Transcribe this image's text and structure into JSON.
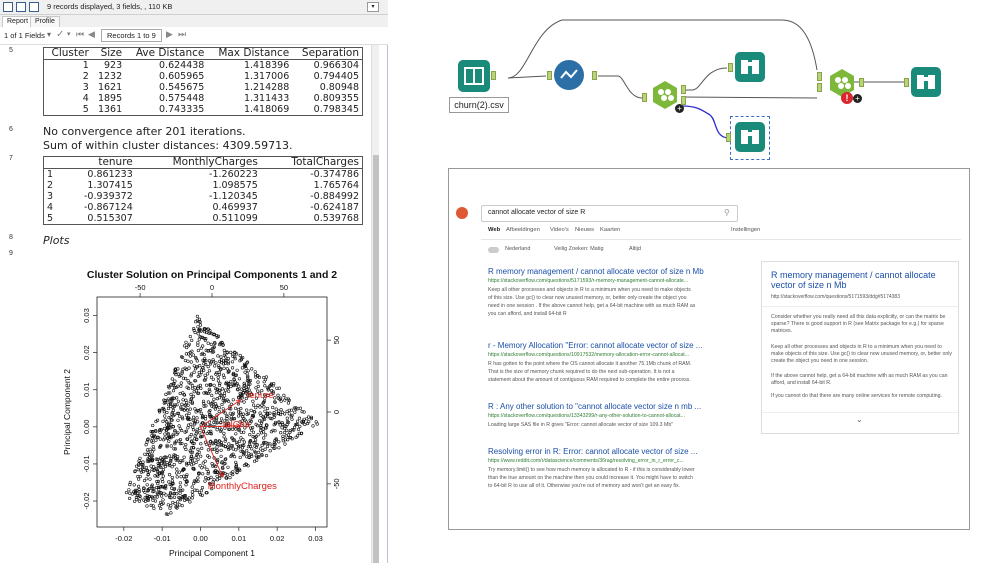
{
  "report": {
    "status": "9 records displayed, 3 fields, , 110 KB",
    "tabs": [
      "Report",
      "Profile"
    ],
    "fields": "1 of 1 Fields",
    "records": "Records 1 to 9",
    "rows": [
      {
        "num": "5"
      },
      {
        "num": "6",
        "lines": [
          "No convergence after 201 iterations.",
          "Sum of within cluster distances: 4309.59713."
        ]
      },
      {
        "num": "7"
      },
      {
        "num": "8",
        "text": "Plots"
      },
      {
        "num": "9"
      }
    ],
    "cluster_table": {
      "headers": [
        "Cluster",
        "Size",
        "Ave Distance",
        "Max Distance",
        "Separation"
      ],
      "rows": [
        [
          "1",
          "923",
          "0.624438",
          "1.418396",
          "0.966304"
        ],
        [
          "2",
          "1232",
          "0.605965",
          "1.317006",
          "0.794405"
        ],
        [
          "3",
          "1621",
          "0.545675",
          "1.214288",
          "0.80948"
        ],
        [
          "4",
          "1895",
          "0.575448",
          "1.311433",
          "0.809355"
        ],
        [
          "5",
          "1361",
          "0.743335",
          "1.418069",
          "0.798345"
        ]
      ]
    },
    "centers_table": {
      "headers": [
        "",
        "tenure",
        "MonthlyCharges",
        "TotalCharges"
      ],
      "rows": [
        [
          "1",
          "0.861233",
          "-1.260223",
          "-0.374786"
        ],
        [
          "2",
          "1.307415",
          "1.098575",
          "1.765764"
        ],
        [
          "3",
          "-0.939372",
          "-1.120345",
          "-0.884992"
        ],
        [
          "4",
          "-0.867124",
          "0.469937",
          "-0.624187"
        ],
        [
          "5",
          "0.515307",
          "0.511099",
          "0.539768"
        ]
      ]
    }
  },
  "chart_data": {
    "type": "scatter",
    "title": "Cluster Solution on Principal Components 1 and 2",
    "xlabel": "Principal Component 1",
    "ylabel": "Principal Component 2",
    "xlim": [
      -0.027,
      0.033
    ],
    "ylim": [
      -0.027,
      0.035
    ],
    "x_ticks": [
      "-0.02",
      "-0.01",
      "0.00",
      "0.01",
      "0.02",
      "0.03"
    ],
    "y_ticks": [
      "-0.02",
      "-0.01",
      "0.00",
      "0.01",
      "0.02",
      "0.03"
    ],
    "top_ticks": [
      "-50",
      "0",
      "50"
    ],
    "right_ticks": [
      "-50",
      "0",
      "50"
    ],
    "vectors": [
      {
        "name": "tenure",
        "x": 0.0105,
        "y": 0.0073
      },
      {
        "name": "TotalCharges",
        "x": 0.0105,
        "y": 0.0003
      },
      {
        "name": "MonthlyCharges",
        "x": 0.0058,
        "y": -0.0135
      }
    ],
    "vector_label_shown": [
      "tenure",
      "talCha",
      "MonthlyCharges"
    ],
    "point_region": [
      [
        -0.02,
        -0.019
      ],
      [
        -0.001,
        0.03
      ],
      [
        0.031,
        0.001
      ],
      [
        -0.008,
        -0.024
      ]
    ],
    "grid": false,
    "legend": "none"
  },
  "workflow": {
    "input_label": "churn(2).csv",
    "tools": [
      "input-book-icon",
      "transform-icon",
      "cluster-icon",
      "browse-icon",
      "browse-icon",
      "cluster-icon",
      "browse-icon",
      "browse-icon"
    ],
    "colors": {
      "teal": "#1a8a7a",
      "blue": "#2c6fa6",
      "green": "#7db83a",
      "error": "#d9272e"
    }
  },
  "browser": {
    "search_query": "cannot allocate vector of size R",
    "tabs": [
      "Web",
      "Afbeeldingen",
      "Video's",
      "Nieuws",
      "Kaarten"
    ],
    "settings": "Instellingen",
    "filters": [
      "Nederland",
      "Veilig Zoeken: Matig",
      "Altijd"
    ],
    "results": [
      {
        "title": "R memory management / cannot allocate vector of size n Mb",
        "url": "https://stackoverflow.com/questions/5171593/r-memory-management-cannot-allocate...",
        "snippet": [
          "Keep all other processes and objects in R to a minimum when you need to make objects",
          "of this size. Use gc() to clear now unused memory, or, better only create the object you",
          "need in one session . If the above cannot help, get a 64-bit machine with as much RAM as",
          "you can afford, and install 64-bit R"
        ]
      },
      {
        "title": "r - Memory Allocation \"Error: cannot allocate vector of size ...",
        "url": "https://stackoverflow.com/questions/10917532/memory-allocation-error-cannot-allocat...",
        "snippet": [
          "R has gotten to the point where the OS cannot allocate it another 75.1Mb chunk of RAM.",
          "That is the size of memory chunk required to do the next sub-operation. It is not a",
          "statement about the amount of contiguous RAM required to complete the entire process."
        ]
      },
      {
        "title": "R : Any other solution to \"cannot allocate vector size n mb ...",
        "url": "https://stackoverflow.com/questions/13343299/r-any-other-solution-to-cannot-allocat...",
        "snippet": [
          "Loading large SAS file in R gives \"Error: cannot allocate vector of size 109.3 Mb\""
        ]
      },
      {
        "title": "Resolving error in R: Error: cannot allocate vector of size ...",
        "url": "https://www.reddit.com/r/datascience/comments/36rag/resolving_error_in_r_error_c...",
        "snippet": [
          "Try memory.limit() to see how much memory is allocated to R - if this is considerably lower",
          "than the true amount on the machine then you could increase it. You might have to switch",
          "to 64-bit R to use all of it. Otherwise you're out of memory and won't get an easy fix."
        ]
      }
    ],
    "sidebar": {
      "title": "R memory management / cannot allocate vector of size n Mb",
      "url": "http://stackoverflow.com/questions/5171593/ddg#5174383",
      "paragraphs": [
        "Consider whether you really need all this data explicitly, or can the matrix be sparse? There is good support in R (see Matrix package for e.g.) for sparse matrices.",
        "Keep all other processes and objects in R to a minimum when you need to make objects of this size. Use gc() to clear now unused memory, or, better only create the object you need in one session.",
        "If the above cannot help, get a 64-bit machine with as much RAM as you can afford, and install 64-bit R.",
        "If you cannot do that there are many online services for remote computing."
      ]
    }
  }
}
